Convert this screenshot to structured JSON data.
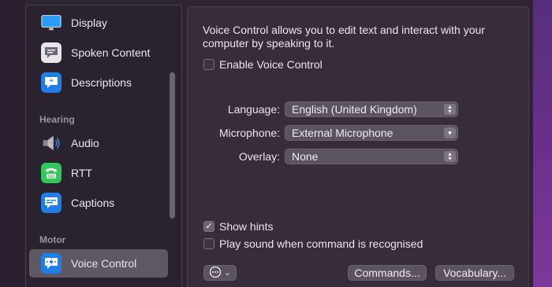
{
  "sidebar": {
    "items": [
      {
        "label": "Display",
        "icon": "display-icon",
        "color": "#2a8cf0"
      },
      {
        "label": "Spoken Content",
        "icon": "speech-bubble-icon",
        "color": "#6d6872"
      },
      {
        "label": "Descriptions",
        "icon": "quote-bubble-icon",
        "color": "#1f7ee8"
      }
    ],
    "section_hearing": "Hearing",
    "hearing_items": [
      {
        "label": "Audio",
        "icon": "speaker-icon"
      },
      {
        "label": "RTT",
        "icon": "tty-icon",
        "color": "#34c759"
      },
      {
        "label": "Captions",
        "icon": "captions-icon",
        "color": "#1f7ee8"
      }
    ],
    "section_motor": "Motor",
    "motor_items": [
      {
        "label": "Voice Control",
        "icon": "voice-control-icon",
        "color": "#1f7ee8",
        "selected": true
      }
    ]
  },
  "main": {
    "description": "Voice Control allows you to edit text and interact with your computer by speaking to it.",
    "enable_label": "Enable Voice Control",
    "enable_checked": false,
    "language_label": "Language:",
    "language_value": "English (United Kingdom)",
    "microphone_label": "Microphone:",
    "microphone_value": "External Microphone",
    "overlay_label": "Overlay:",
    "overlay_value": "None",
    "show_hints_label": "Show hints",
    "show_hints_checked": true,
    "play_sound_label": "Play sound when command is recognised",
    "play_sound_checked": false,
    "commands_button": "Commands...",
    "vocabulary_button": "Vocabulary...",
    "more_button_icon": "ellipsis-circle-icon"
  }
}
